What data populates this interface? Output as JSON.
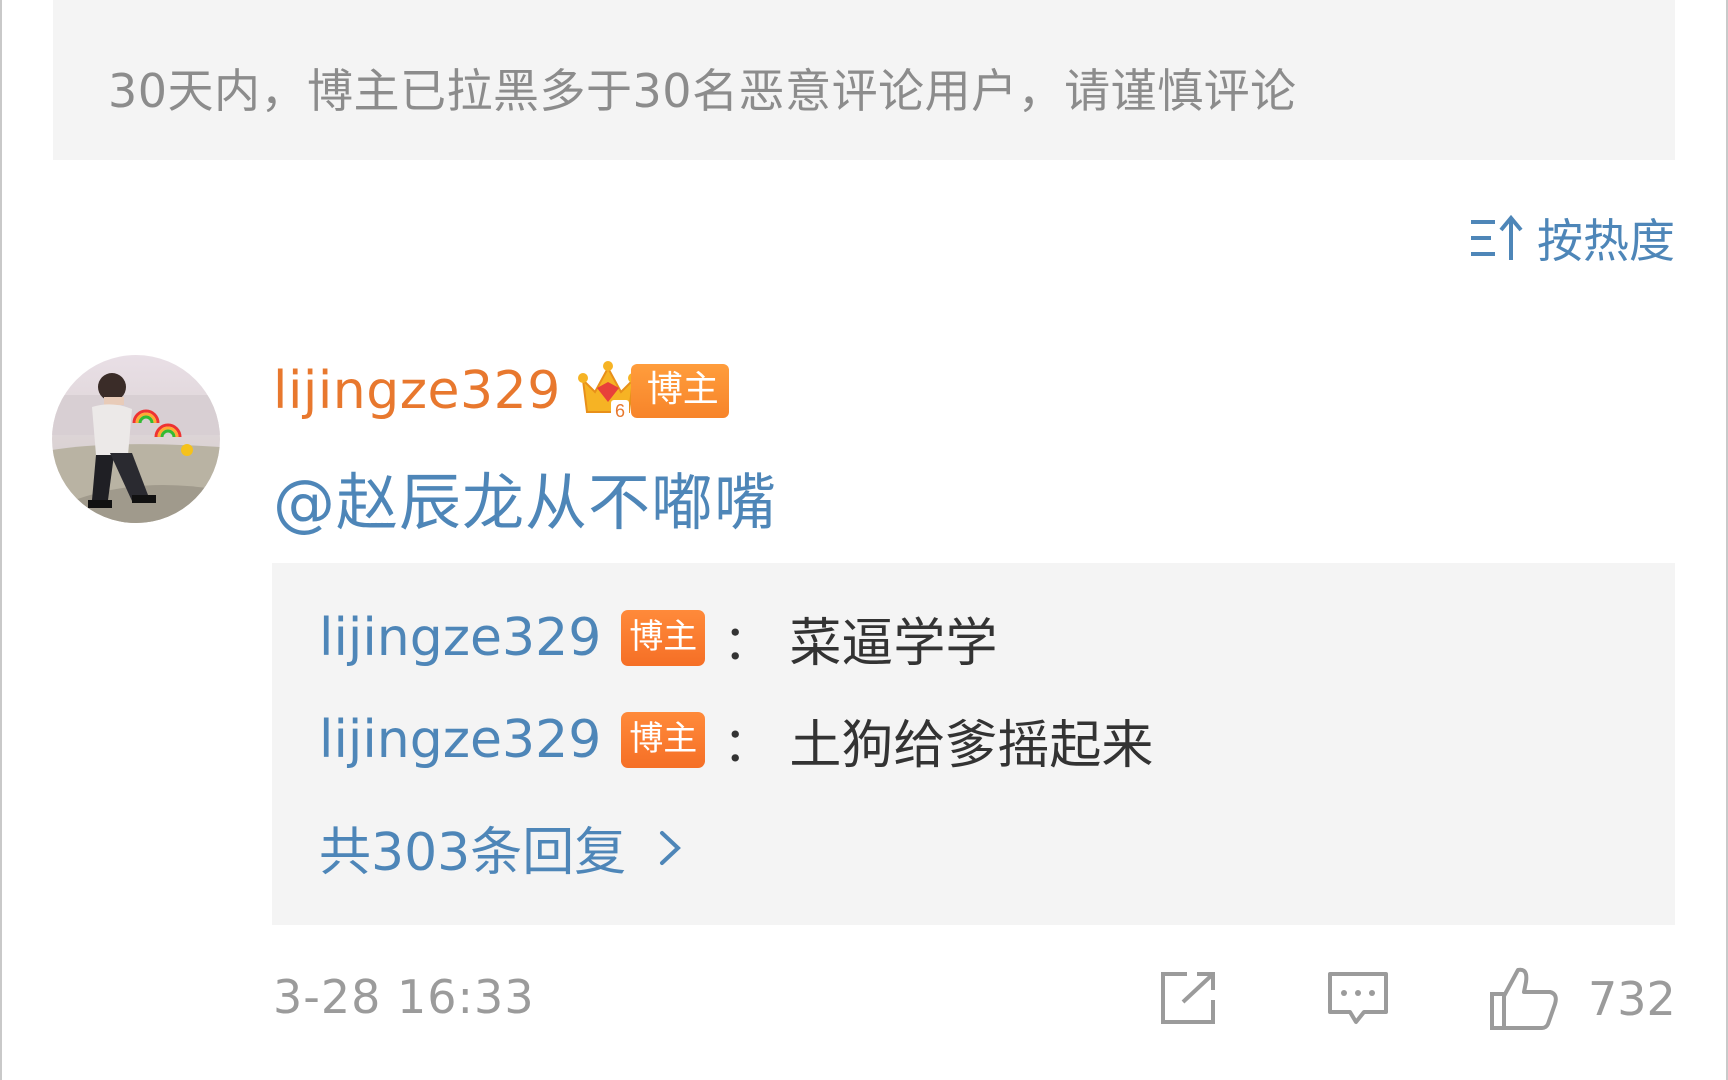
{
  "notice": {
    "text": "30天内，博主已拉黑多于30名恶意评论用户，请谨慎评论"
  },
  "sort": {
    "label": "按热度",
    "icon": "sort-icon"
  },
  "comment": {
    "username": "lijingze329",
    "badge_level": "6",
    "badge_label": "博主",
    "mention": "@赵辰龙从不嘟嘴",
    "replies": [
      {
        "user": "lijingze329",
        "badge": "博主",
        "colon": "：",
        "text": "菜逼学学"
      },
      {
        "user": "lijingze329",
        "badge": "博主",
        "colon": "：",
        "text": "土狗给爹摇起来"
      }
    ],
    "more_replies": "共303条回复",
    "timestamp": "3-28 16:33",
    "like_count": "732"
  },
  "colors": {
    "link_blue": "#4e86b8",
    "username_orange": "#e8782e",
    "badge_orange": "#f7842a",
    "panel_gray": "#f4f4f4",
    "meta_gray": "#9b9b9b"
  }
}
